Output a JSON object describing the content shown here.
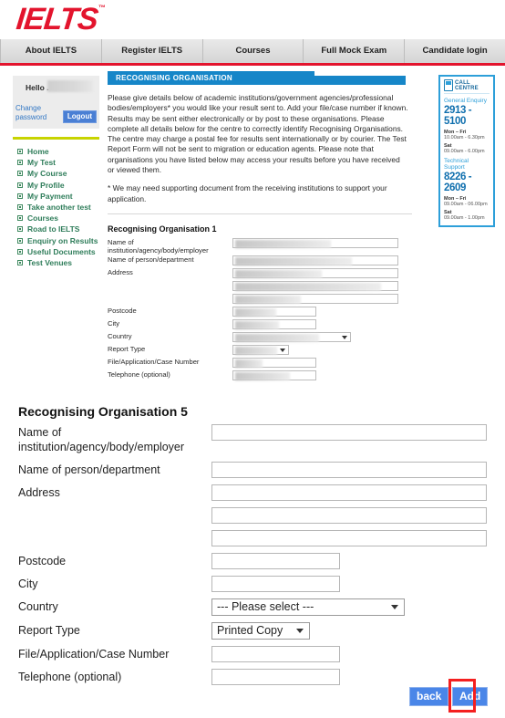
{
  "brand": {
    "logo_text": "IELTS",
    "logo_tm": "™",
    "red": "#e3142d",
    "blue": "#1686c8",
    "green": "#2f7d5a",
    "lime": "#c8d400"
  },
  "nav": {
    "items": [
      {
        "label": "About IELTS"
      },
      {
        "label": "Register IELTS"
      },
      {
        "label": "Courses"
      },
      {
        "label": "Full Mock Exam"
      },
      {
        "label": "Candidate login"
      }
    ]
  },
  "sidebar": {
    "greeting": "Hello .",
    "change_password": "Change password",
    "logout": "Logout",
    "menu": [
      {
        "label": "Home"
      },
      {
        "label": "My Test"
      },
      {
        "label": "My Course"
      },
      {
        "label": "My Profile"
      },
      {
        "label": "My Payment"
      },
      {
        "label": "Take another test"
      },
      {
        "label": "Courses"
      },
      {
        "label": "Road to IELTS"
      },
      {
        "label": "Enquiry on Results"
      },
      {
        "label": "Useful Documents"
      },
      {
        "label": "Test Venues"
      }
    ]
  },
  "call_centre": {
    "title": "CALL CENTRE",
    "general": {
      "label": "General Enquiry",
      "number": "2913 - 5100",
      "weekday_label": "Mon – Fri",
      "weekday_hours": "10.00am - 6.30pm",
      "sat_label": "Sat",
      "sat_hours": "09.00am - 6.00pm"
    },
    "technical": {
      "label": "Technical Support",
      "number": "8226 - 2609",
      "weekday_label": "Mon – Fri",
      "weekday_hours": "09.00am - 06.00pm",
      "sat_label": "Sat",
      "sat_hours": "09.00am - 1.00pm"
    }
  },
  "panel": {
    "title": "RECOGNISING ORGANISATION",
    "intro": "Please give details below of academic institutions/government agencies/professional bodies/employers* you would like your result sent to. Add your file/case number if known. Results may be sent either electronically or by post to these organisations. Please complete all details below for the centre to correctly identify Recognising Organisations. The centre may charge a postal fee for results sent internationally or by courier. The Test Report Form will not be sent to migration or education agents. Please note that organisations you have listed below may access your results before you have received or viewed them.",
    "note": "* We may need supporting document from the receiving institutions to support your application."
  },
  "org_one": {
    "title": "Recognising Organisation 1",
    "labels": {
      "name_institution": "Name of institution/agency/body/employer",
      "name_person": "Name of person/department",
      "address": "Address",
      "postcode": "Postcode",
      "city": "City",
      "country": "Country",
      "report_type": "Report Type",
      "file_number": "File/Application/Case Number",
      "telephone": "Telephone (optional)"
    }
  },
  "org_five": {
    "title": "Recognising Organisation 5",
    "labels": {
      "name_institution": "Name of institution/agency/body/employer",
      "name_person": "Name of person/department",
      "address": "Address",
      "postcode": "Postcode",
      "city": "City",
      "country": "Country",
      "report_type": "Report Type",
      "file_number": "File/Application/Case Number",
      "telephone": "Telephone (optional)"
    },
    "values": {
      "name_institution": "",
      "name_person": "",
      "address_1": "",
      "address_2": "",
      "address_3": "",
      "postcode": "",
      "city": "",
      "country": "--- Please select ---",
      "report_type": "Printed Copy",
      "file_number": "",
      "telephone": ""
    }
  },
  "buttons": {
    "back": "back",
    "add": "Add",
    "highlight_color": "#f41f1f"
  }
}
